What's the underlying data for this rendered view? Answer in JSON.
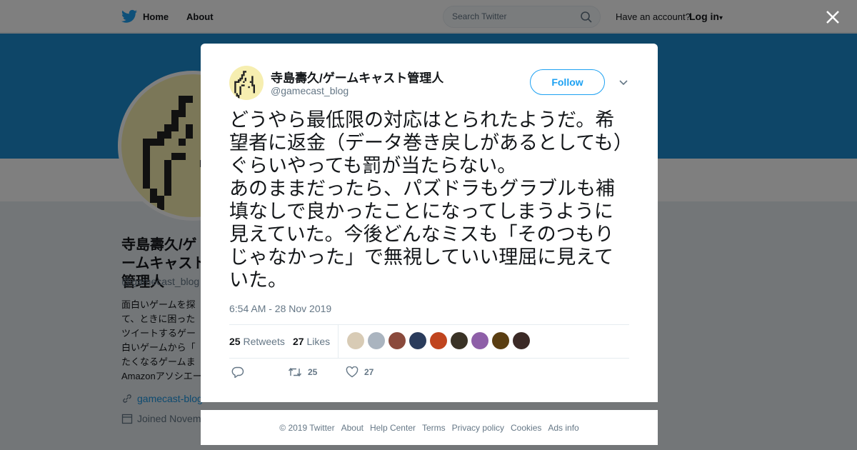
{
  "topbar": {
    "home_label": "Home",
    "about_label": "About",
    "search_placeholder": "Search Twitter",
    "account_text": "Have an account?",
    "login_label": "Log in"
  },
  "profile": {
    "name": "寺島壽久/ゲームキャスト管理人",
    "handle": "@gamecast_blog",
    "bio_visible": "面白いゲームを探\nて、ときに困った\nツイートするゲー\n白いゲームから「\nたくなるゲームま\nAmazonアソシエー",
    "link": "gamecast-blog",
    "joined": "Joined Novem"
  },
  "tweet": {
    "author_name": "寺島壽久/ゲームキャスト管理人",
    "author_handle": "@gamecast_blog",
    "follow_label": "Follow",
    "text": "どうやら最低限の対応はとられたようだ。希望者に返金（データ巻き戻しがあるとしても）ぐらいやっても罰が当たらない。\nあのままだったら、パズドラもグラブルも補填なしで良かったことになってしまうように見えていた。今後どんなミスも「そのつもりじゃなかった」で無視していい理屈に見えていた。",
    "timestamp": "6:54 AM - 28 Nov 2019",
    "retweets_count": "25",
    "retweets_label": "Retweets",
    "likes_count": "27",
    "likes_label": "Likes",
    "reply_count": "",
    "retweet_action_count": "25",
    "like_action_count": "27"
  },
  "footer": {
    "links": [
      "© 2019 Twitter",
      "About",
      "Help Center",
      "Terms",
      "Privacy policy",
      "Cookies",
      "Ads info"
    ]
  },
  "colors": {
    "brand": "#1da1f2",
    "banner": "#1d8dd0",
    "muted": "#657786"
  }
}
